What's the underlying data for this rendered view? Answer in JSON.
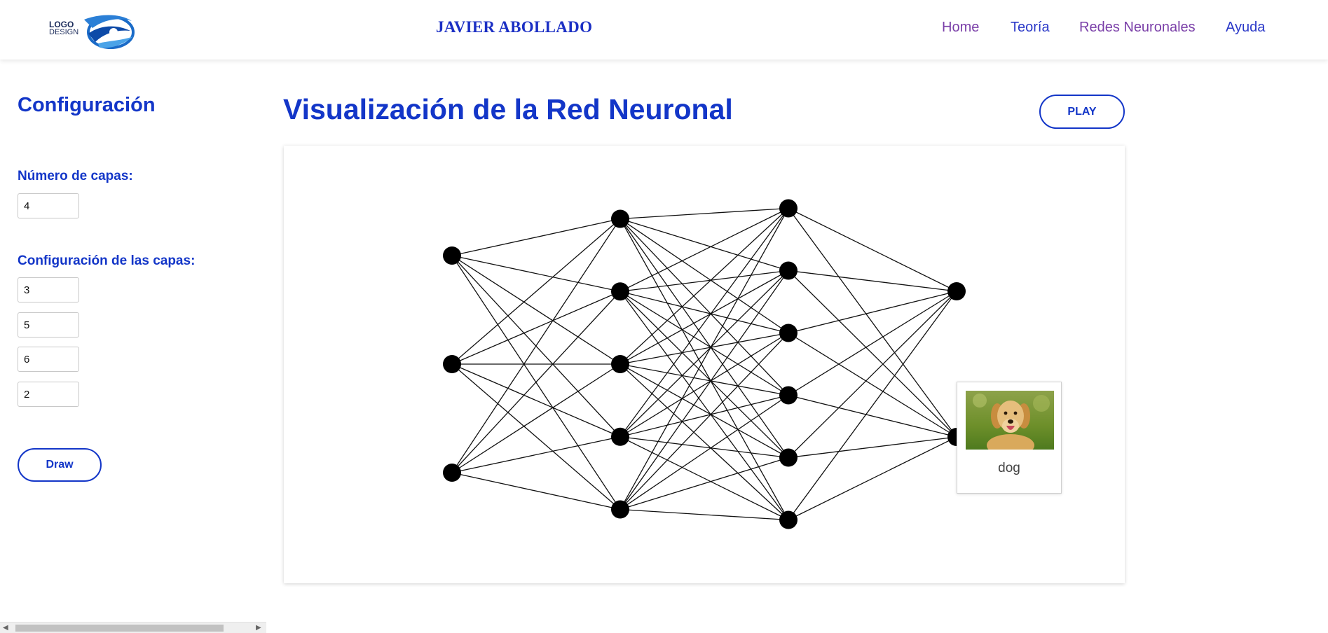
{
  "header": {
    "logo_text_line1": "LOGO",
    "logo_text_line2": "DESIGN",
    "site_title": "JAVIER ABOLLADO",
    "nav": [
      {
        "label": "Home"
      },
      {
        "label": "Teoría"
      },
      {
        "label": "Redes Neuronales"
      },
      {
        "label": "Ayuda"
      }
    ]
  },
  "sidebar": {
    "title": "Configuración",
    "layers_label": "Número de capas:",
    "layers_value": "4",
    "config_label": "Configuración de las capas:",
    "layer_sizes": [
      "3",
      "5",
      "6",
      "2"
    ],
    "draw_button": "Draw"
  },
  "main": {
    "title": "Visualización de la Red Neuronal",
    "play_button": "PLAY",
    "network": {
      "layers": [
        3,
        5,
        6,
        2
      ],
      "node_color": "#000000",
      "edge_color": "#111111"
    },
    "prediction": {
      "image_icon": "dog-photo",
      "label": "dog"
    }
  },
  "colors": {
    "primary": "#1336c8",
    "nav_visited": "#7a3fa8",
    "nav_link": "#2a38c8"
  }
}
